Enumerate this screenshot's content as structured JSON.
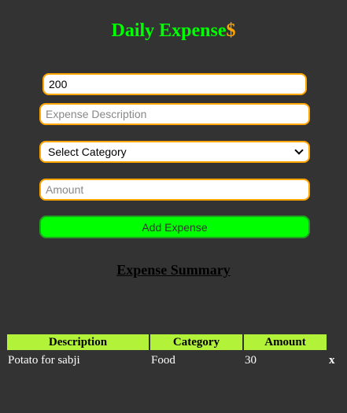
{
  "header": {
    "title_main": "Daily Expense",
    "title_suffix": "$"
  },
  "form": {
    "top_amount_value": "200",
    "description_placeholder": "Expense Description",
    "category_selected": "Select Category",
    "amount_placeholder": "Amount",
    "add_button_label": "Add Expense"
  },
  "summary": {
    "heading": "Expense Summary",
    "columns": [
      "Description",
      "Category",
      "Amount"
    ],
    "rows": [
      {
        "description": "Potato for sabji",
        "category": "Food",
        "amount": "30",
        "delete_label": "x"
      }
    ]
  },
  "colors": {
    "background": "#333333",
    "title_green": "#00ff00",
    "dollar_orange": "#ffa500",
    "input_border": "#ffa500",
    "button_green": "#00ff00",
    "header_cell": "#b2f33a"
  },
  "icons": {
    "category_dropdown": "chevron-down-icon"
  }
}
